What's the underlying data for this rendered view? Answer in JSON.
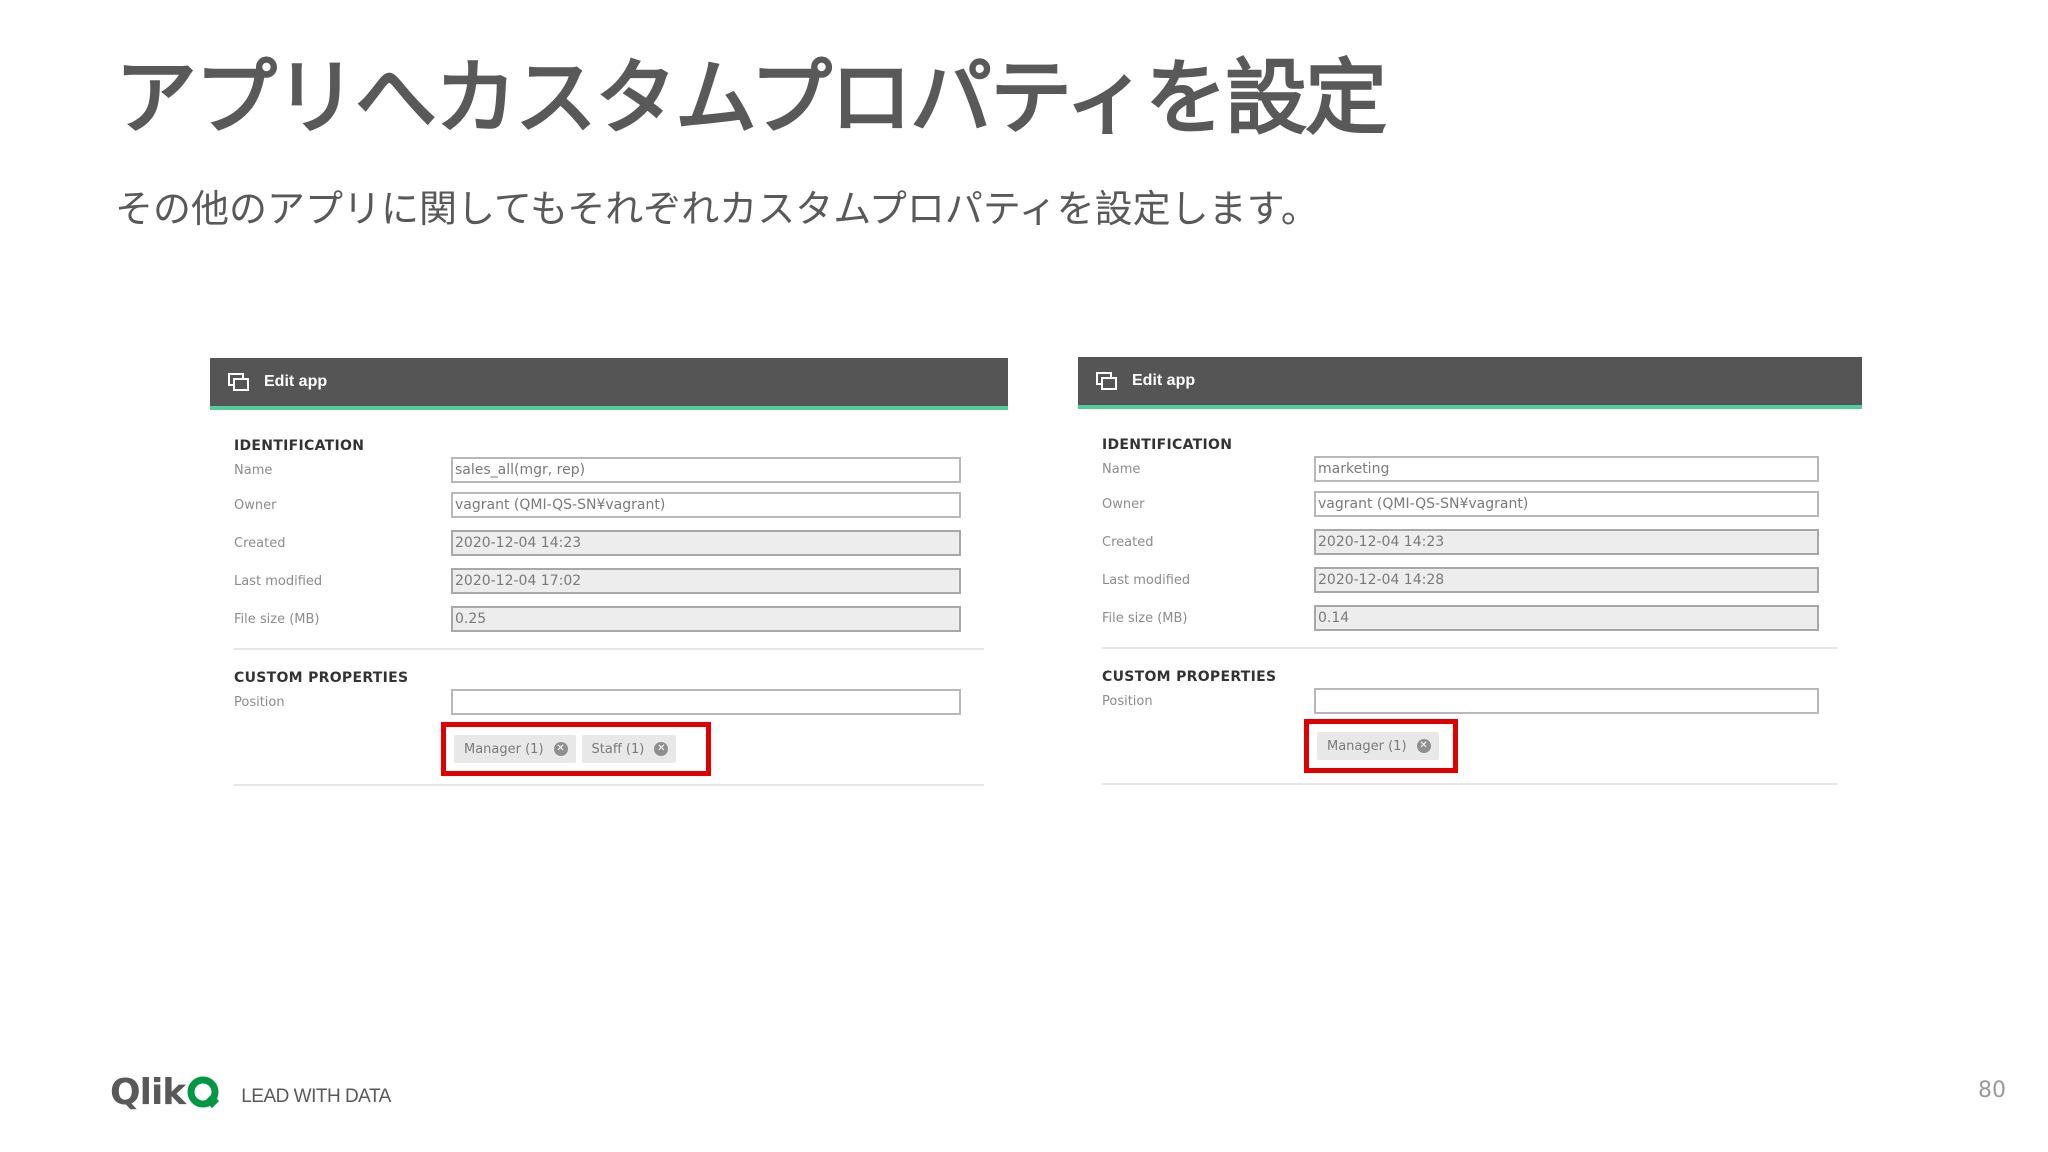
{
  "slide": {
    "title": "アプリへカスタムプロパティを設定",
    "subtitle": "その他のアプリに関してもそれぞれカスタムプロパティを設定します。",
    "page_number": "80"
  },
  "footer": {
    "brand": "Qlik",
    "tagline": "LEAD WITH DATA"
  },
  "panels": [
    {
      "header": "Edit app",
      "identification_heading": "IDENTIFICATION",
      "fields": [
        {
          "label": "Name",
          "value": "sales_all(mgr, rep)"
        },
        {
          "label": "Owner",
          "value": "vagrant (QMI-QS-SN¥vagrant)"
        },
        {
          "label": "Created",
          "value": "2020-12-04 14:23"
        },
        {
          "label": "Last modified",
          "value": "2020-12-04 17:02"
        },
        {
          "label": "File size (MB)",
          "value": "0.25"
        }
      ],
      "custom_heading": "CUSTOM PROPERTIES",
      "custom_label": "Position",
      "custom_input_value": "",
      "tags": [
        "Manager (1)",
        "Staff (1)"
      ]
    },
    {
      "header": "Edit app",
      "identification_heading": "IDENTIFICATION",
      "fields": [
        {
          "label": "Name",
          "value": "marketing"
        },
        {
          "label": "Owner",
          "value": "vagrant (QMI-QS-SN¥vagrant)"
        },
        {
          "label": "Created",
          "value": "2020-12-04 14:23"
        },
        {
          "label": "Last modified",
          "value": "2020-12-04 14:28"
        },
        {
          "label": "File size (MB)",
          "value": "0.14"
        }
      ],
      "custom_heading": "CUSTOM PROPERTIES",
      "custom_label": "Position",
      "custom_input_value": "",
      "tags": [
        "Manager (1)"
      ]
    }
  ],
  "colors": {
    "header_bg": "#555555",
    "header_accent": "#52cc9b",
    "highlight": "#e00000",
    "qlik_green": "#009845"
  },
  "icons": {
    "header": "edit-app-icon",
    "tag_remove": "remove-circle-icon",
    "logo": "qlik-logo-icon"
  }
}
